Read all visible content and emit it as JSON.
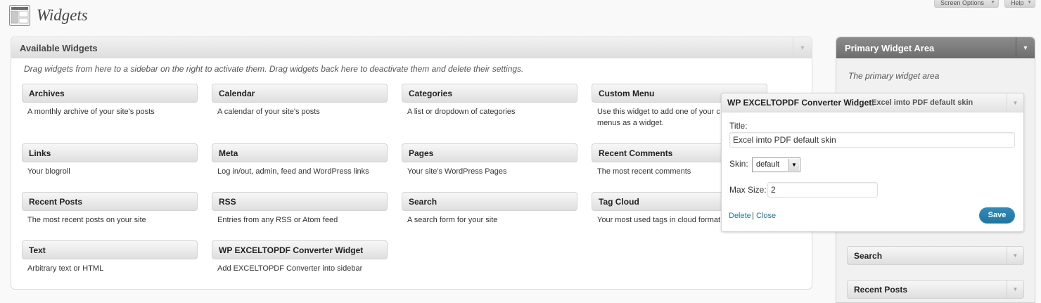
{
  "page": {
    "title": "Widgets",
    "screen_options": "Screen Options",
    "help": "Help",
    "page_icon": "widgets-layout-icon"
  },
  "available": {
    "title": "Available Widgets",
    "description": "Drag widgets from here to a sidebar on the right to activate them. Drag widgets back here to deactivate them and delete their settings.",
    "widgets": [
      {
        "name": "Archives",
        "desc": "A monthly archive of your site's posts"
      },
      {
        "name": "Calendar",
        "desc": "A calendar of your site's posts"
      },
      {
        "name": "Categories",
        "desc": "A list or dropdown of categories"
      },
      {
        "name": "Custom Menu",
        "desc": "Use this widget to add one of your c",
        "desc2": "menus as a widget."
      },
      {
        "name": "Links",
        "desc": "Your blogroll"
      },
      {
        "name": "Meta",
        "desc": "Log in/out, admin, feed and WordPress links"
      },
      {
        "name": "Pages",
        "desc": "Your site's WordPress Pages"
      },
      {
        "name": "Recent Comments",
        "desc": "The most recent comments"
      },
      {
        "name": "Recent Posts",
        "desc": "The most recent posts on your site"
      },
      {
        "name": "RSS",
        "desc": "Entries from any RSS or Atom feed"
      },
      {
        "name": "Search",
        "desc": "A search form for your site"
      },
      {
        "name": "Tag Cloud",
        "desc": "Your most used tags in cloud format"
      },
      {
        "name": "Text",
        "desc": "Arbitrary text or HTML"
      },
      {
        "name": "WP EXCELTOPDF Converter Widget",
        "desc": "Add EXCELTOPDF Converter into sidebar"
      }
    ]
  },
  "primary": {
    "title": "Primary Widget Area",
    "description": "The primary widget area",
    "widgets": [
      "Search",
      "Recent Posts"
    ]
  },
  "expanded_widget": {
    "title": "WP EXCELTOPDF Converter Widget:",
    "subtitle": "Excel imto PDF default skin",
    "title_label": "Title:",
    "title_value": "Excel imto PDF default skin",
    "skin_label": "Skin:",
    "skin_value": "default",
    "max_size_label": "Max Size:",
    "max_size_value": "2",
    "delete_label": "Delete",
    "separator": "|",
    "close_label": "Close",
    "save_label": "Save"
  },
  "colors": {
    "accent": "#21759b",
    "primary_header": "#7a7a7a",
    "save_button": "#2e8bbd"
  }
}
